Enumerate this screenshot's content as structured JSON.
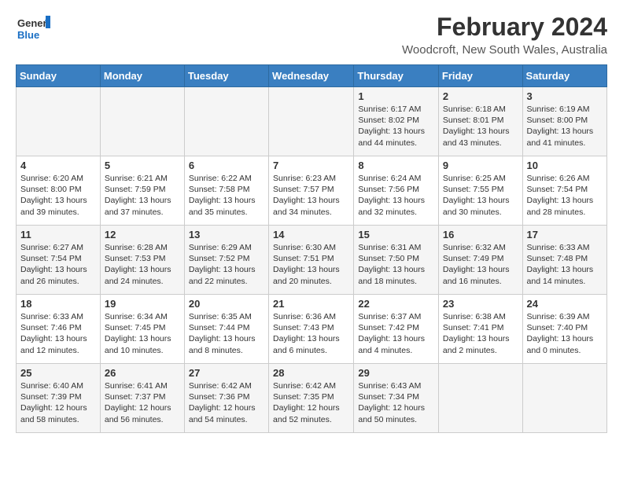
{
  "header": {
    "logo_general": "General",
    "logo_blue": "Blue",
    "month_year": "February 2024",
    "location": "Woodcroft, New South Wales, Australia"
  },
  "weekdays": [
    "Sunday",
    "Monday",
    "Tuesday",
    "Wednesday",
    "Thursday",
    "Friday",
    "Saturday"
  ],
  "weeks": [
    [
      {
        "day": "",
        "info": ""
      },
      {
        "day": "",
        "info": ""
      },
      {
        "day": "",
        "info": ""
      },
      {
        "day": "",
        "info": ""
      },
      {
        "day": "1",
        "info": "Sunrise: 6:17 AM\nSunset: 8:02 PM\nDaylight: 13 hours\nand 44 minutes."
      },
      {
        "day": "2",
        "info": "Sunrise: 6:18 AM\nSunset: 8:01 PM\nDaylight: 13 hours\nand 43 minutes."
      },
      {
        "day": "3",
        "info": "Sunrise: 6:19 AM\nSunset: 8:00 PM\nDaylight: 13 hours\nand 41 minutes."
      }
    ],
    [
      {
        "day": "4",
        "info": "Sunrise: 6:20 AM\nSunset: 8:00 PM\nDaylight: 13 hours\nand 39 minutes."
      },
      {
        "day": "5",
        "info": "Sunrise: 6:21 AM\nSunset: 7:59 PM\nDaylight: 13 hours\nand 37 minutes."
      },
      {
        "day": "6",
        "info": "Sunrise: 6:22 AM\nSunset: 7:58 PM\nDaylight: 13 hours\nand 35 minutes."
      },
      {
        "day": "7",
        "info": "Sunrise: 6:23 AM\nSunset: 7:57 PM\nDaylight: 13 hours\nand 34 minutes."
      },
      {
        "day": "8",
        "info": "Sunrise: 6:24 AM\nSunset: 7:56 PM\nDaylight: 13 hours\nand 32 minutes."
      },
      {
        "day": "9",
        "info": "Sunrise: 6:25 AM\nSunset: 7:55 PM\nDaylight: 13 hours\nand 30 minutes."
      },
      {
        "day": "10",
        "info": "Sunrise: 6:26 AM\nSunset: 7:54 PM\nDaylight: 13 hours\nand 28 minutes."
      }
    ],
    [
      {
        "day": "11",
        "info": "Sunrise: 6:27 AM\nSunset: 7:54 PM\nDaylight: 13 hours\nand 26 minutes."
      },
      {
        "day": "12",
        "info": "Sunrise: 6:28 AM\nSunset: 7:53 PM\nDaylight: 13 hours\nand 24 minutes."
      },
      {
        "day": "13",
        "info": "Sunrise: 6:29 AM\nSunset: 7:52 PM\nDaylight: 13 hours\nand 22 minutes."
      },
      {
        "day": "14",
        "info": "Sunrise: 6:30 AM\nSunset: 7:51 PM\nDaylight: 13 hours\nand 20 minutes."
      },
      {
        "day": "15",
        "info": "Sunrise: 6:31 AM\nSunset: 7:50 PM\nDaylight: 13 hours\nand 18 minutes."
      },
      {
        "day": "16",
        "info": "Sunrise: 6:32 AM\nSunset: 7:49 PM\nDaylight: 13 hours\nand 16 minutes."
      },
      {
        "day": "17",
        "info": "Sunrise: 6:33 AM\nSunset: 7:48 PM\nDaylight: 13 hours\nand 14 minutes."
      }
    ],
    [
      {
        "day": "18",
        "info": "Sunrise: 6:33 AM\nSunset: 7:46 PM\nDaylight: 13 hours\nand 12 minutes."
      },
      {
        "day": "19",
        "info": "Sunrise: 6:34 AM\nSunset: 7:45 PM\nDaylight: 13 hours\nand 10 minutes."
      },
      {
        "day": "20",
        "info": "Sunrise: 6:35 AM\nSunset: 7:44 PM\nDaylight: 13 hours\nand 8 minutes."
      },
      {
        "day": "21",
        "info": "Sunrise: 6:36 AM\nSunset: 7:43 PM\nDaylight: 13 hours\nand 6 minutes."
      },
      {
        "day": "22",
        "info": "Sunrise: 6:37 AM\nSunset: 7:42 PM\nDaylight: 13 hours\nand 4 minutes."
      },
      {
        "day": "23",
        "info": "Sunrise: 6:38 AM\nSunset: 7:41 PM\nDaylight: 13 hours\nand 2 minutes."
      },
      {
        "day": "24",
        "info": "Sunrise: 6:39 AM\nSunset: 7:40 PM\nDaylight: 13 hours\nand 0 minutes."
      }
    ],
    [
      {
        "day": "25",
        "info": "Sunrise: 6:40 AM\nSunset: 7:39 PM\nDaylight: 12 hours\nand 58 minutes."
      },
      {
        "day": "26",
        "info": "Sunrise: 6:41 AM\nSunset: 7:37 PM\nDaylight: 12 hours\nand 56 minutes."
      },
      {
        "day": "27",
        "info": "Sunrise: 6:42 AM\nSunset: 7:36 PM\nDaylight: 12 hours\nand 54 minutes."
      },
      {
        "day": "28",
        "info": "Sunrise: 6:42 AM\nSunset: 7:35 PM\nDaylight: 12 hours\nand 52 minutes."
      },
      {
        "day": "29",
        "info": "Sunrise: 6:43 AM\nSunset: 7:34 PM\nDaylight: 12 hours\nand 50 minutes."
      },
      {
        "day": "",
        "info": ""
      },
      {
        "day": "",
        "info": ""
      }
    ]
  ]
}
